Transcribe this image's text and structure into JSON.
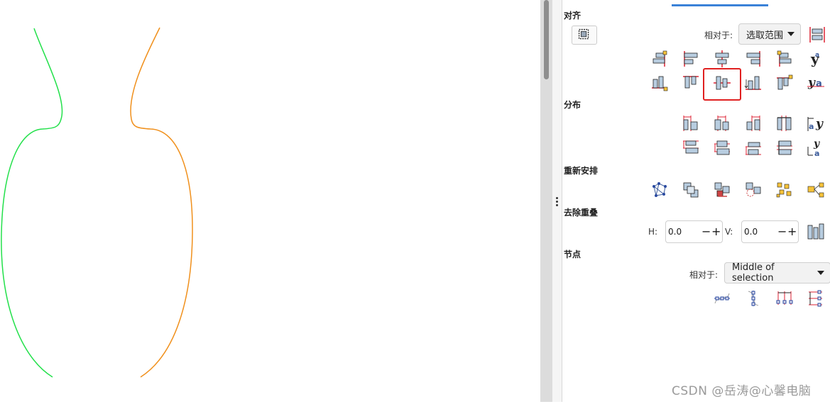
{
  "panel": {
    "align_title": "对齐",
    "relative_to_label": "相对于:",
    "relative_to_value": "选取范围",
    "distribute_title": "分布",
    "rearrange_title": "重新安排",
    "remove_overlap_title": "去除重叠",
    "h_label": "H:",
    "h_value": "0.0",
    "v_label": "V:",
    "v_value": "0.0",
    "nodes_title": "节点",
    "nodes_relative_label": "相对于:",
    "nodes_relative_value": "Middle of selection"
  },
  "watermark": "CSDN @岳涛@心馨电脑",
  "colors": {
    "left_curve": "#22e04a",
    "right_curve": "#f0901c",
    "highlight": "#e02020",
    "tab_indicator": "#3a82d8"
  }
}
